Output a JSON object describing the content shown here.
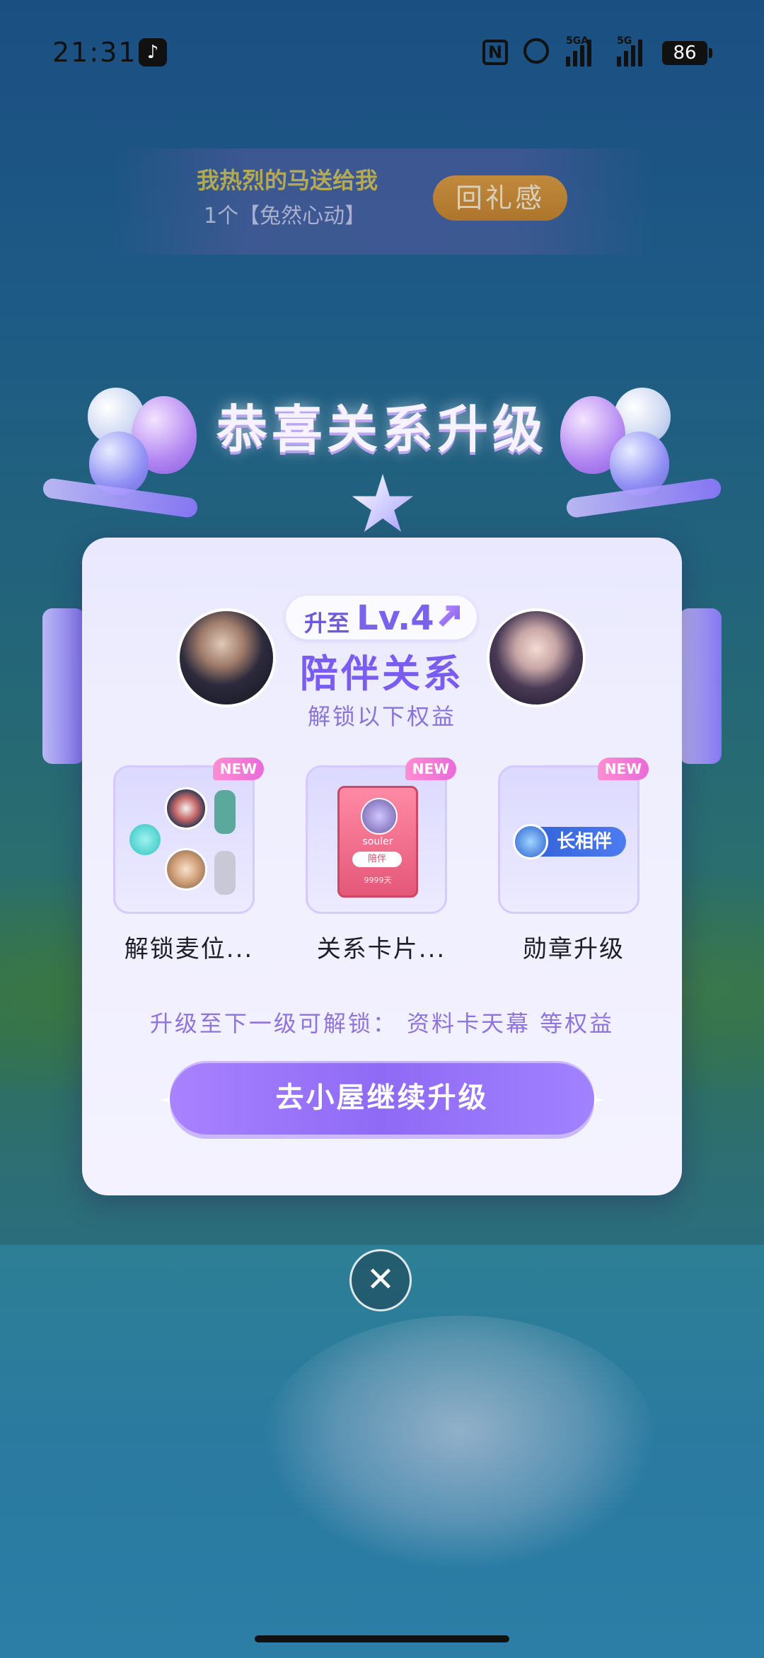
{
  "status_bar": {
    "time": "21:31",
    "signal1_label": "5GA",
    "signal2_label": "5G",
    "battery": "86"
  },
  "gift_banner": {
    "line1": "我热烈的马送给我",
    "line2": "1个【兔然心动】",
    "button_label": "回礼感"
  },
  "modal": {
    "title": "恭喜关系升级",
    "level_prefix": "升至",
    "level_value": "Lv.4",
    "relation_name": "陪伴关系",
    "unlock_subtitle": "解锁以下权益",
    "benefits": [
      {
        "label": "解锁麦位...",
        "badge": "NEW"
      },
      {
        "label": "关系卡片...",
        "badge": "NEW",
        "card_name": "souler",
        "card_tag": "陪伴",
        "card_days": "9999天"
      },
      {
        "label": "勋章升级",
        "badge": "NEW",
        "medal_text": "长相伴"
      }
    ],
    "next_level_text": "升级至下一级可解锁： 资料卡天幕 等权益",
    "upgrade_button": "去小屋继续升级",
    "close_symbol": "✕"
  },
  "colors": {
    "accent_purple": "#7a5cf0",
    "button_purple": "#8f6af5",
    "new_badge": "#e86bd9",
    "gift_button": "#c27b1a"
  },
  "icons": [
    "tiktok-icon",
    "nfc-icon",
    "alarm-icon",
    "signal-icon",
    "battery-icon",
    "star-icon",
    "arrow-up-icon",
    "medal-icon",
    "close-icon",
    "sparkle-icon"
  ]
}
